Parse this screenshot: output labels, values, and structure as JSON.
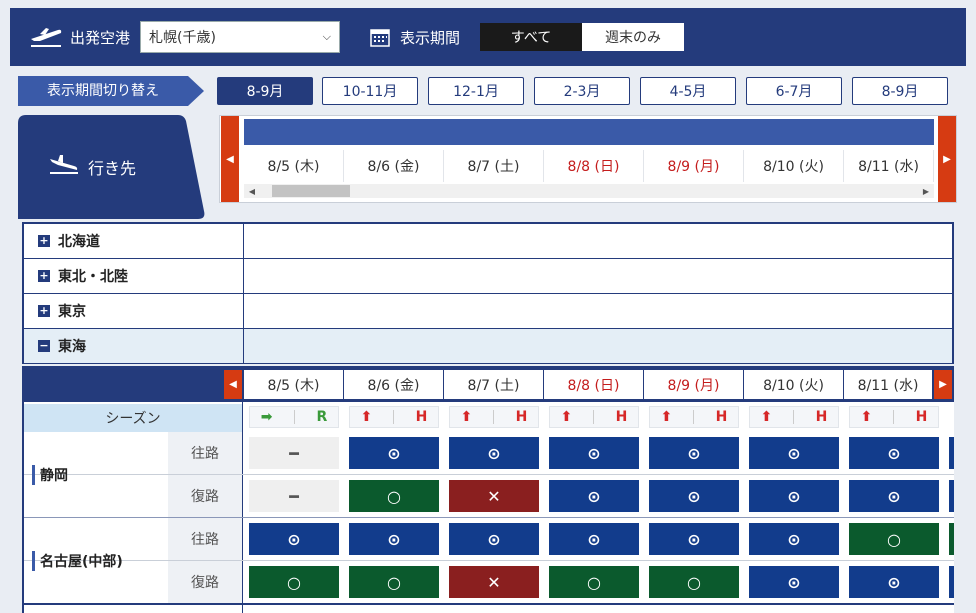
{
  "header": {
    "departure_label": "出発空港",
    "departure_value": "札幌(千歳)",
    "period_label": "表示期間",
    "period_options": [
      "すべて",
      "週末のみ"
    ]
  },
  "period_switch": {
    "title": "表示期間切り替え",
    "tabs": [
      "8-9月",
      "10-11月",
      "12-1月",
      "2-3月",
      "4-5月",
      "6-7月",
      "8-9月"
    ],
    "active_index": 0
  },
  "destination_label": "行き先",
  "dates": [
    {
      "label": "8/5 (木)",
      "red": false
    },
    {
      "label": "8/6 (金)",
      "red": false
    },
    {
      "label": "8/7 (土)",
      "red": false
    },
    {
      "label": "8/8 (日)",
      "red": true
    },
    {
      "label": "8/9 (月)",
      "red": true
    },
    {
      "label": "8/10 (火)",
      "red": false
    },
    {
      "label": "8/11 (水)",
      "red": false
    }
  ],
  "regions": [
    {
      "name": "北海道",
      "expanded": false
    },
    {
      "name": "東北・北陸",
      "expanded": false
    },
    {
      "name": "東京",
      "expanded": false
    },
    {
      "name": "東海",
      "expanded": true
    }
  ],
  "season": {
    "label": "シーズン",
    "cells": [
      {
        "arrow": "➡",
        "letter": "R",
        "color": "#3a9a3a"
      },
      {
        "arrow": "⬆",
        "letter": "H",
        "color": "#d62828"
      },
      {
        "arrow": "⬆",
        "letter": "H",
        "color": "#d62828"
      },
      {
        "arrow": "⬆",
        "letter": "H",
        "color": "#d62828"
      },
      {
        "arrow": "⬆",
        "letter": "H",
        "color": "#d62828"
      },
      {
        "arrow": "⬆",
        "letter": "H",
        "color": "#d62828"
      },
      {
        "arrow": "⬆",
        "letter": "H",
        "color": "#d62828"
      }
    ]
  },
  "routes": [
    {
      "city": "静岡",
      "legs": [
        {
          "dir": "往路",
          "cells": [
            "none",
            "blue",
            "blue",
            "blue",
            "blue",
            "blue",
            "blue"
          ]
        },
        {
          "dir": "復路",
          "cells": [
            "none",
            "green",
            "red",
            "blue",
            "blue",
            "blue",
            "blue"
          ]
        }
      ]
    },
    {
      "city": "名古屋(中部)",
      "legs": [
        {
          "dir": "往路",
          "cells": [
            "blue",
            "blue",
            "blue",
            "blue",
            "blue",
            "blue",
            "green"
          ]
        },
        {
          "dir": "復路",
          "cells": [
            "green",
            "green",
            "red",
            "green",
            "green",
            "blue",
            "blue"
          ]
        }
      ]
    }
  ],
  "symbols": {
    "blue": "⊙",
    "green": "○",
    "red": "✕",
    "none": "━"
  },
  "colors": {
    "navy": "#243b7c",
    "accent_red": "#d63b12",
    "cell_blue": "#123c8c",
    "cell_green": "#0b5a2d",
    "cell_red": "#8a1f1f"
  }
}
